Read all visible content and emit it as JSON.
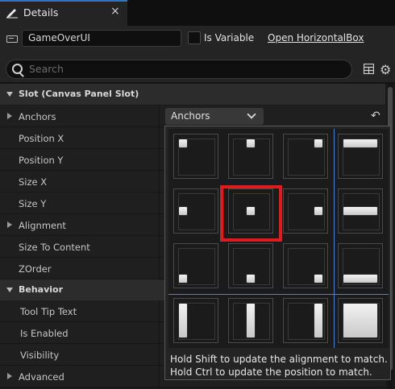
{
  "tab": {
    "title": "Details",
    "close": "×",
    "icon": "pencil-icon"
  },
  "header": {
    "name_value": "GameOverUI",
    "is_variable_label": "Is Variable",
    "is_variable_checked": false,
    "open_link": "Open HorizontalBox",
    "search_placeholder": "Search"
  },
  "sections": [
    {
      "label": "Slot (Canvas Panel Slot)"
    },
    {
      "label": "Behavior"
    }
  ],
  "slot_properties": [
    {
      "label": "Anchors",
      "expandable": true
    },
    {
      "label": "Position X"
    },
    {
      "label": "Position Y"
    },
    {
      "label": "Size X"
    },
    {
      "label": "Size Y"
    },
    {
      "label": "Alignment",
      "expandable": true
    },
    {
      "label": "Size To Content"
    },
    {
      "label": "ZOrder"
    }
  ],
  "behavior_properties": [
    {
      "label": "Tool Tip Text"
    },
    {
      "label": "Is Enabled"
    },
    {
      "label": "Visibility"
    }
  ],
  "advanced": {
    "label": "Advanced"
  },
  "anchors_combo": {
    "value": "Anchors"
  },
  "anchor_popup": {
    "hint_line1": "Hold Shift to update the alignment to match.",
    "hint_line2": "Hold Ctrl to update the position to match.",
    "selected_cell": "middle-center",
    "highlight_color": "#e11b1b",
    "divider_color": "#4a84d2"
  }
}
